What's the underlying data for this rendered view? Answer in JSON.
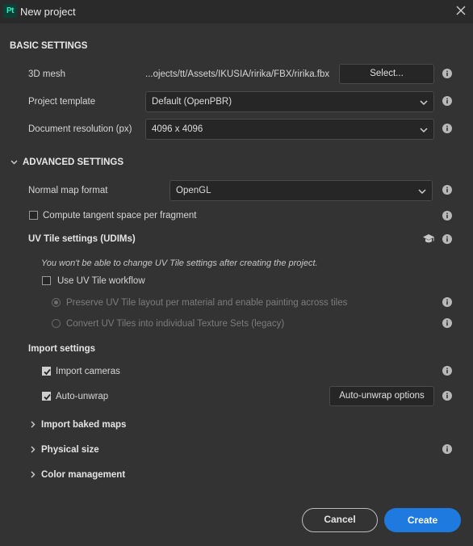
{
  "window": {
    "title": "New project",
    "app_logo": "Pt",
    "icons": {
      "close": "close-icon",
      "info": "info-icon",
      "learn": "graduation-cap-icon",
      "chevron": "chevron-down-icon",
      "caret": "chevron-right-icon"
    }
  },
  "basic": {
    "heading": "BASIC SETTINGS",
    "mesh_label": "3D mesh",
    "mesh_path": "...ojects/tt/Assets/IKUSIA/ririka/FBX/ririka.fbx",
    "select_label": "Select...",
    "template_label": "Project template",
    "template_value": "Default (OpenPBR)",
    "resolution_label": "Document resolution (px)",
    "resolution_value": "4096 x 4096"
  },
  "advanced": {
    "heading": "ADVANCED SETTINGS",
    "normal_label": "Normal map format",
    "normal_value": "OpenGL",
    "tangent_label": "Compute tangent space per fragment",
    "tangent_checked": false,
    "uv_heading": "UV Tile settings (UDIMs)",
    "uv_note": "You won't be able to change UV Tile settings after creating the project.",
    "uv_workflow_label": "Use UV Tile workflow",
    "uv_workflow_checked": false,
    "uv_option_preserve": "Preserve UV Tile layout per material and enable painting across tiles",
    "uv_option_convert": "Convert UV Tiles into individual Texture Sets (legacy)",
    "import_heading": "Import settings",
    "import_cameras_label": "Import cameras",
    "import_cameras_checked": true,
    "auto_unwrap_label": "Auto-unwrap",
    "auto_unwrap_checked": true,
    "auto_unwrap_options": "Auto-unwrap options",
    "baked_maps": "Import baked maps",
    "physical_size": "Physical size",
    "color_management": "Color management"
  },
  "footer": {
    "cancel": "Cancel",
    "create": "Create"
  },
  "colors": {
    "background": "#333333",
    "titlebar": "#2a2a2a",
    "field": "#262626",
    "accent": "#1f7ae0"
  }
}
